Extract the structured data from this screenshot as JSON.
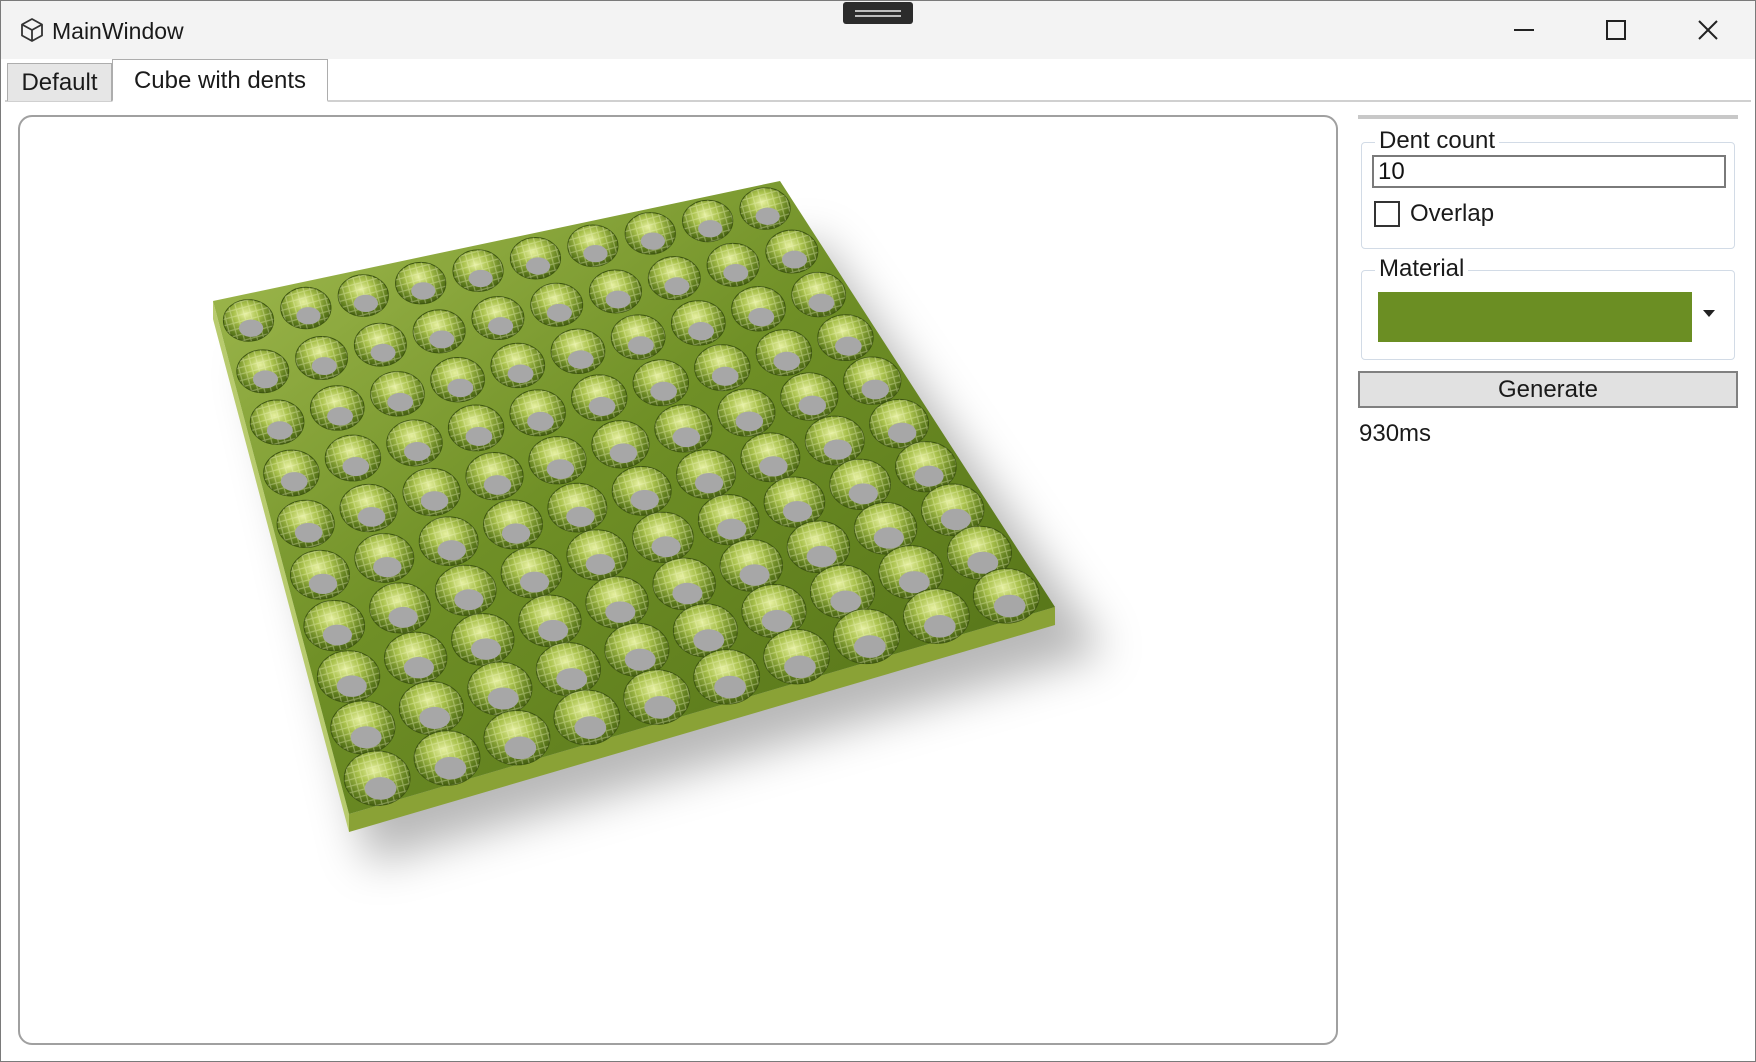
{
  "window": {
    "title": "MainWindow",
    "icon": "cube-icon"
  },
  "caption_buttons": {
    "minimize": "minimize-icon",
    "maximize": "maximize-icon",
    "close": "close-icon"
  },
  "tabs": [
    {
      "label": "Default",
      "selected": false
    },
    {
      "label": "Cube with dents",
      "selected": true
    }
  ],
  "viewport": {
    "content": "3d-render",
    "grid_rows": 10,
    "grid_cols": 10
  },
  "panel": {
    "dent_group": {
      "title": "Dent count",
      "value": "10",
      "overlap_label": "Overlap",
      "overlap_checked": false
    },
    "material_group": {
      "title": "Material",
      "color": "#6b8e23"
    },
    "generate_label": "Generate",
    "timing": "930ms"
  },
  "colors": {
    "material": "#6b8e23",
    "material_light": "#b8cb6e",
    "hole": "#a7a7a7",
    "border": "#a0a0a0"
  }
}
